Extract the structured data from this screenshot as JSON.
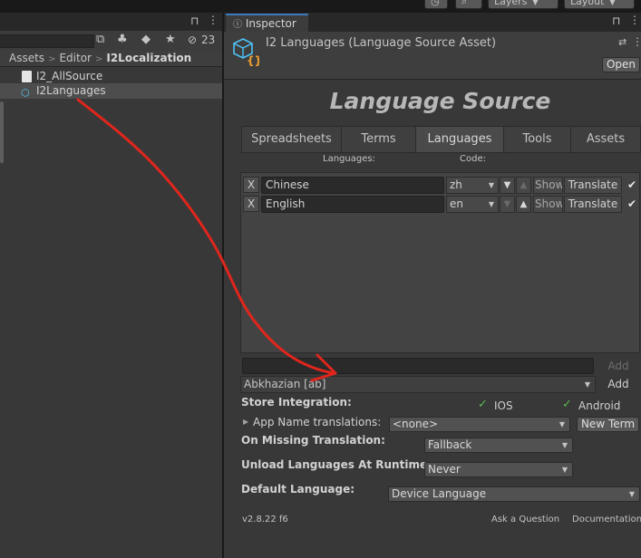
{
  "top_toolbar": {
    "layers_label": "Layers",
    "layout_label": "Layout"
  },
  "project": {
    "visible_count": "23",
    "breadcrumb": [
      "Assets",
      "Editor",
      "I2Localization"
    ],
    "files": [
      {
        "name": "I2_AllSource",
        "icon": "script-file-icon",
        "selected": false
      },
      {
        "name": "I2Languages",
        "icon": "language-source-asset-icon",
        "selected": true
      }
    ]
  },
  "inspector": {
    "tab_label": "Inspector",
    "asset_title": "I2 Languages (Language Source Asset)",
    "open_label": "Open",
    "big_title": "Language Source",
    "tabs": [
      {
        "label": "Spreadsheets",
        "active": false
      },
      {
        "label": "Terms",
        "active": false
      },
      {
        "label": "Languages",
        "active": true
      },
      {
        "label": "Tools",
        "active": false
      },
      {
        "label": "Assets",
        "active": false
      }
    ],
    "col_languages": "Languages:",
    "col_code": "Code:",
    "languages": [
      {
        "remove": "X",
        "name": "Chinese",
        "code": "zh",
        "show": "Show",
        "translate": "Translate",
        "enabled": true
      },
      {
        "remove": "X",
        "name": "English",
        "code": "en",
        "show": "Show",
        "translate": "Translate",
        "enabled": true
      }
    ],
    "add_label": "Add",
    "selected_language": "Abkhazian [ab]",
    "add2_label": "Add",
    "store_integration_label": "Store Integration:",
    "ios_label": "IOS",
    "android_label": "Android",
    "app_name_label": "App Name translations:",
    "app_name_value": "<none>",
    "new_term_label": "New Term",
    "missing_translation_label": "On Missing Translation:",
    "missing_translation_value": "Fallback",
    "unload_label": "Unload Languages At Runtime:",
    "unload_value": "Never",
    "default_language_label": "Default Language:",
    "default_language_value": "Device Language",
    "version": "v2.8.22 f6",
    "ask_question": "Ask a Question",
    "documentation": "Documentation"
  },
  "colors": {
    "accent_tab": "#3a79bb",
    "annotation_arrow": "#e0261c",
    "check_green": "#58b84e"
  }
}
